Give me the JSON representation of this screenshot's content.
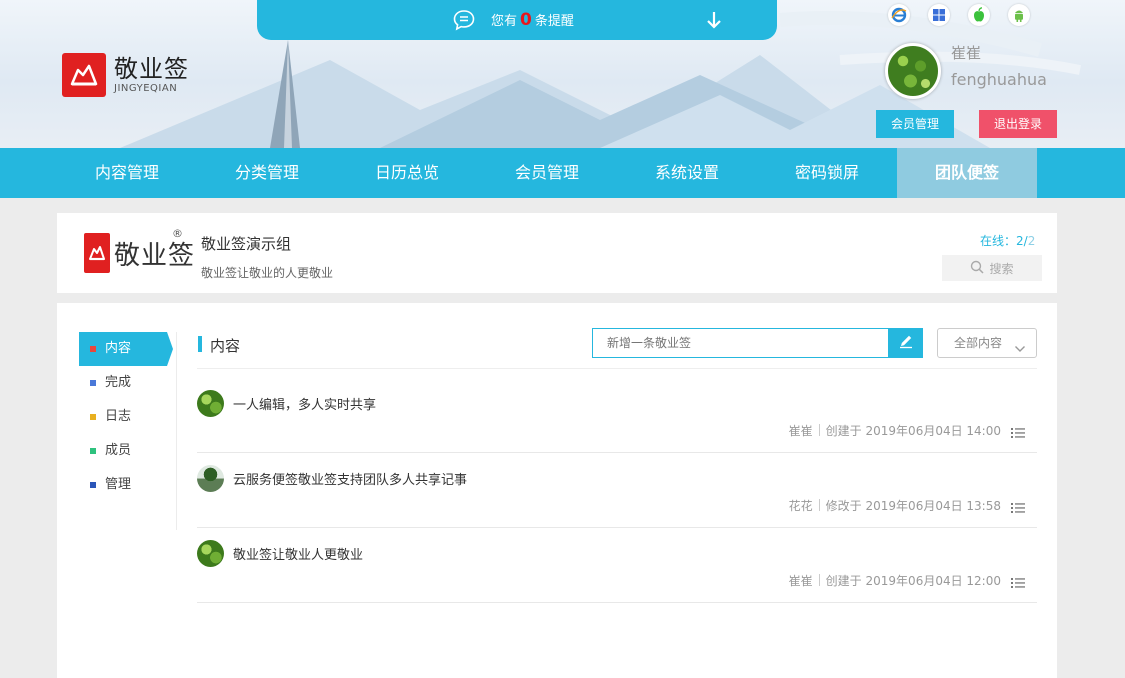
{
  "notice": {
    "prefix": "您有",
    "count": "0",
    "suffix": "条提醒"
  },
  "logo": {
    "title": "敬业签",
    "subtitle": "JINGYEQIAN"
  },
  "platforms": [
    "ie-icon",
    "windows-icon",
    "apple-icon",
    "android-icon"
  ],
  "user": {
    "name": "崔崔",
    "id": "fenghuahua",
    "member_btn": "会员管理",
    "logout_btn": "退出登录"
  },
  "nav": [
    "内容管理",
    "分类管理",
    "日历总览",
    "会员管理",
    "系统设置",
    "密码锁屏",
    "团队便签"
  ],
  "nav_active": "团队便签",
  "team": {
    "logo_text": "敬业签",
    "reg_mark": "®",
    "name": "敬业签演示组",
    "desc": "敬业签让敬业的人更敬业",
    "online_label": "在线：",
    "online_current": "2",
    "online_sep": "/",
    "online_total": "2",
    "search_placeholder": "搜索"
  },
  "sidebar": [
    {
      "label": "内容",
      "color": "#e8473c",
      "active": true
    },
    {
      "label": "完成",
      "color": "#4a78d8"
    },
    {
      "label": "日志",
      "color": "#e8b020"
    },
    {
      "label": "成员",
      "color": "#2ec27e"
    },
    {
      "label": "管理",
      "color": "#2a55b8"
    }
  ],
  "content": {
    "section_title": "内容",
    "new_placeholder": "新增一条敬业签",
    "filter_label": "全部内容"
  },
  "notes": [
    {
      "title": "一人编辑，多人实时共享",
      "author": "崔崔",
      "action": "创建于",
      "time": "2019年06月04日 14:00"
    },
    {
      "title": "云服务便签敬业签支持团队多人共享记事",
      "author": "花花",
      "action": "修改于",
      "time": "2019年06月04日 13:58"
    },
    {
      "title": "敬业签让敬业人更敬业",
      "author": "崔崔",
      "action": "创建于",
      "time": "2019年06月04日 12:00"
    }
  ],
  "colors": {
    "accent": "#25b7de",
    "logout": "#f0516a",
    "logo_red": "#e02020"
  }
}
